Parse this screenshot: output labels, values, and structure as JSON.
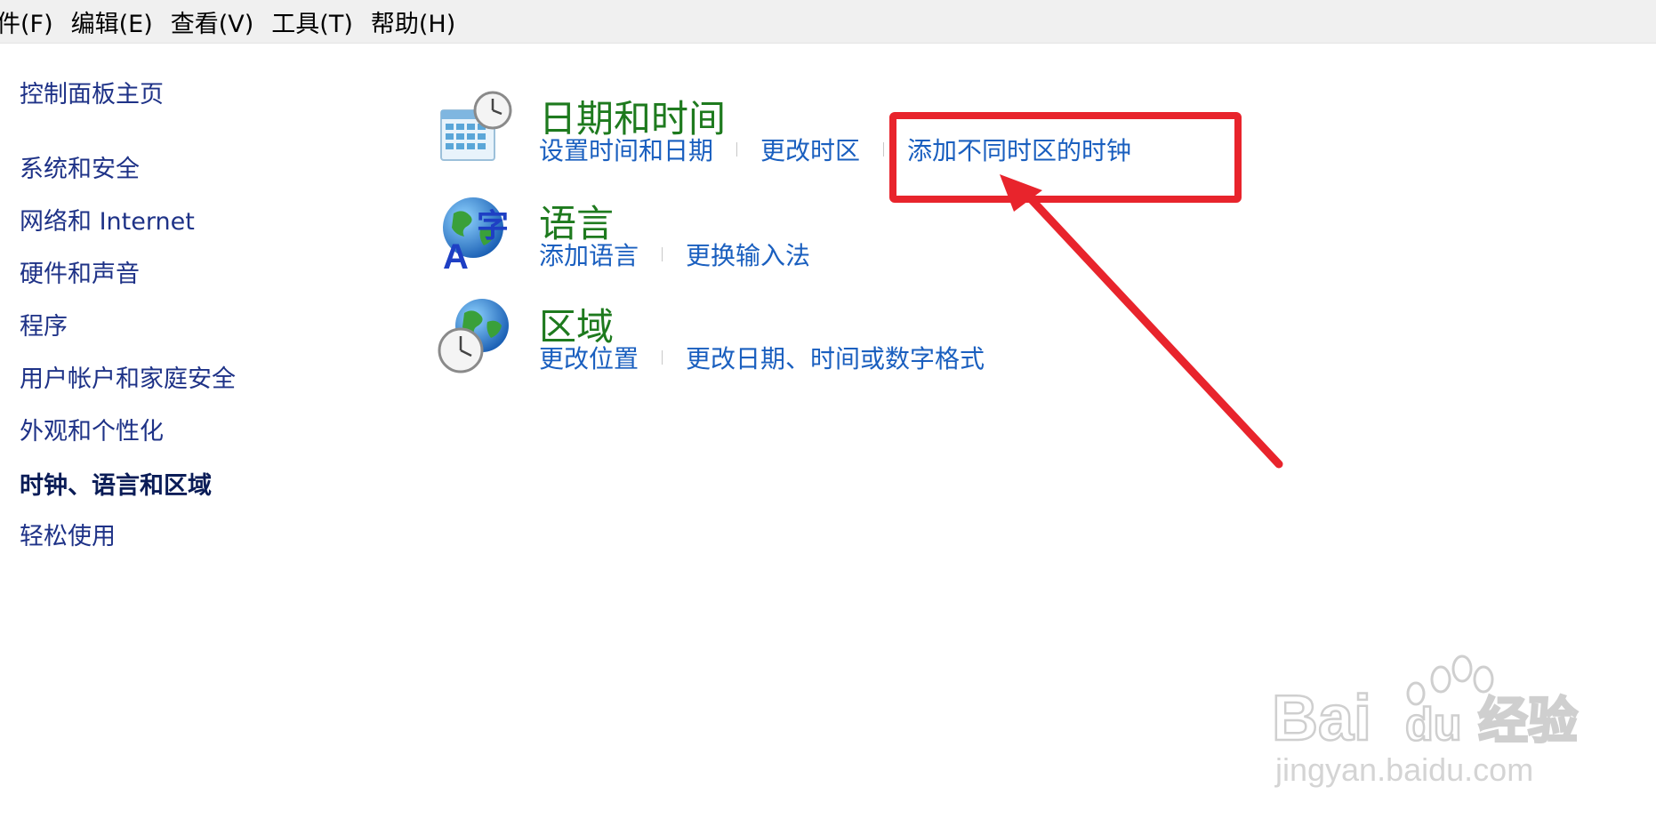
{
  "menubar": {
    "items": [
      "件(F)",
      "编辑(E)",
      "查看(V)",
      "工具(T)",
      "帮助(H)"
    ]
  },
  "sidebar": {
    "home": "控制面板主页",
    "items": [
      "系统和安全",
      "网络和 Internet",
      "硬件和声音",
      "程序",
      "用户帐户和家庭安全",
      "外观和个性化",
      "时钟、语言和区域",
      "轻松使用"
    ],
    "active_index": 6
  },
  "categories": [
    {
      "title": "日期和时间",
      "icon": "calendar-clock-icon",
      "links": [
        "设置时间和日期",
        "更改时区",
        "添加不同时区的时钟"
      ]
    },
    {
      "title": "语言",
      "icon": "language-globe-icon",
      "links": [
        "添加语言",
        "更换输入法"
      ]
    },
    {
      "title": "区域",
      "icon": "region-globe-clock-icon",
      "links": [
        "更改位置",
        "更改日期、时间或数字格式"
      ]
    }
  ],
  "annotation": {
    "color": "#e8242c",
    "highlight_target": "添加不同时区的时钟"
  },
  "watermark": {
    "brand": "Bai du 经验",
    "url": "jingyan.baidu.com"
  },
  "colors": {
    "category_title": "#1e7a1e",
    "link": "#1a5fbf",
    "sidebar_text": "#1e3287"
  }
}
